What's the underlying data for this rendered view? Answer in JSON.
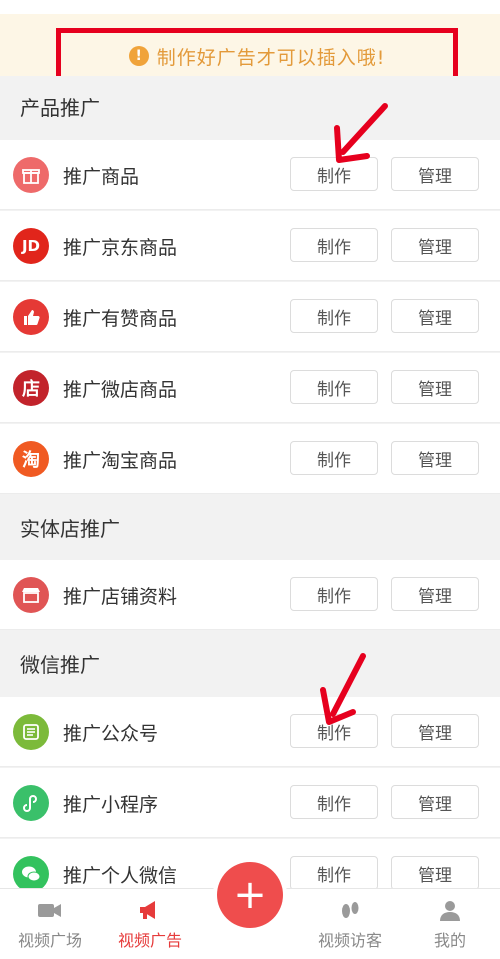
{
  "notice": {
    "icon": "!",
    "text": "制作好广告才可以插入哦!"
  },
  "sections": [
    {
      "title": "产品推广"
    },
    {
      "title": "实体店推广"
    },
    {
      "title": "微信推广"
    }
  ],
  "rows": [
    {
      "label": "推广商品",
      "icon": "gift-icon",
      "color": "#ee6a6a"
    },
    {
      "label": "推广京东商品",
      "icon": "jd-icon",
      "icon_text": "JD",
      "color": "#e1251b"
    },
    {
      "label": "推广有赞商品",
      "icon": "thumbs-up-icon",
      "color": "#e53935"
    },
    {
      "label": "推广微店商品",
      "icon": "store-icon",
      "icon_text": "店",
      "color": "#c2232b"
    },
    {
      "label": "推广淘宝商品",
      "icon": "taobao-icon",
      "icon_text": "淘",
      "color": "#f05a22"
    },
    {
      "label": "推广店铺资料",
      "icon": "shop-icon",
      "color": "#e05555"
    },
    {
      "label": "推广公众号",
      "icon": "list-icon",
      "color": "#7cba3a"
    },
    {
      "label": "推广小程序",
      "icon": "mini-program-icon",
      "color": "#3ac06a"
    },
    {
      "label": "推广个人微信",
      "icon": "wechat-icon",
      "color": "#33c25e"
    }
  ],
  "buttons": {
    "make": "制作",
    "manage": "管理"
  },
  "tabs": [
    {
      "label": "视频广场",
      "icon": "video-camera-icon"
    },
    {
      "label": "视频广告",
      "icon": "megaphone-icon"
    },
    {
      "label": "视频访客",
      "icon": "footprint-icon"
    },
    {
      "label": "我的",
      "icon": "person-icon"
    }
  ],
  "fab": {
    "label": "+"
  },
  "colors": {
    "accent": "#e63b3b",
    "notice_border": "#e6001e",
    "notice_text": "#e39a3a"
  }
}
